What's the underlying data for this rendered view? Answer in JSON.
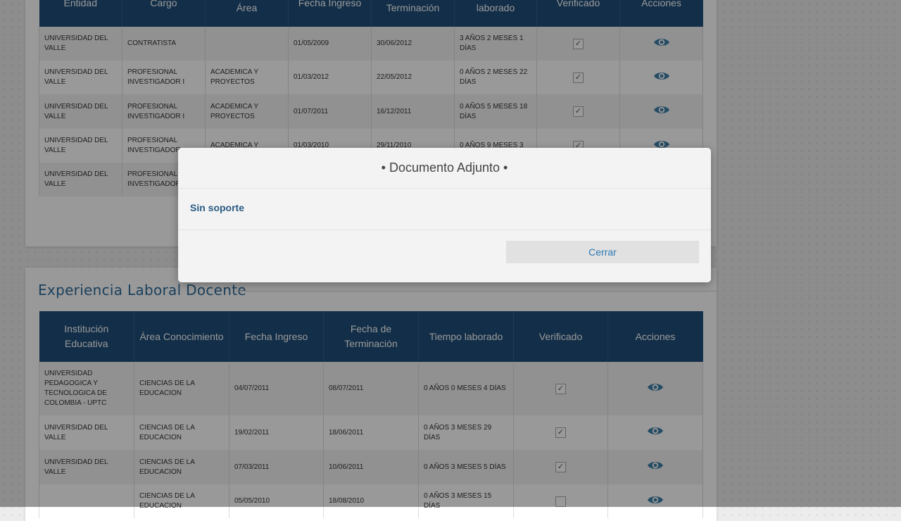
{
  "laboral": {
    "headers": [
      "Entidad",
      "Cargo",
      "Área",
      "Fecha Ingreso",
      "Terminación",
      "laborado",
      "Verificado",
      "Acciones"
    ],
    "rows": [
      {
        "entidad": "UNIVERSIDAD DEL VALLE",
        "cargo": "CONTRATISTA",
        "area": "",
        "ingreso": "01/05/2009",
        "terminacion": "30/06/2012",
        "tiempo": "3 AÑOS 2 MESES 1 DÍAS",
        "verificado": true
      },
      {
        "entidad": "UNIVERSIDAD DEL VALLE",
        "cargo": "PROFESIONAL INVESTIGADOR I",
        "area": "ACADEMICA Y PROYECTOS",
        "ingreso": "01/03/2012",
        "terminacion": "22/05/2012",
        "tiempo": "0 AÑOS 2 MESES 22 DÍAS",
        "verificado": true
      },
      {
        "entidad": "UNIVERSIDAD DEL VALLE",
        "cargo": "PROFESIONAL INVESTIGADOR I",
        "area": "ACADEMICA Y PROYECTOS",
        "ingreso": "01/07/2011",
        "terminacion": "16/12/2011",
        "tiempo": "0 AÑOS 5 MESES 18 DÍAS",
        "verificado": true
      },
      {
        "entidad": "UNIVERSIDAD DEL VALLE",
        "cargo": "PROFESIONAL INVESTIGADOR",
        "area": "ACADEMICA Y",
        "ingreso": "01/03/2010",
        "terminacion": "29/11/2010",
        "tiempo": "0 AÑOS 9 MESES 3",
        "verificado": true
      },
      {
        "entidad": "UNIVERSIDAD DEL VALLE",
        "cargo": "PROFESIONAL INVESTIGADOR",
        "area": "",
        "ingreso": "",
        "terminacion": "",
        "tiempo": "",
        "verificado": true
      }
    ]
  },
  "docente": {
    "title": "Experiencia Laboral Docente",
    "headers": [
      "Institución Educativa",
      "Área Conocimiento",
      "Fecha Ingreso",
      "Fecha de Terminación",
      "Tiempo laborado",
      "Verificado",
      "Acciones"
    ],
    "rows": [
      {
        "institucion": "UNIVERSIDAD PEDAGOGICA Y TECNOLOGICA DE COLOMBIA - UPTC",
        "area": "CIENCIAS DE LA EDUCACION",
        "ingreso": "04/07/2011",
        "terminacion": "08/07/2011",
        "tiempo": "0 AÑOS 0 MESES 4 DÍAS",
        "verificado": true
      },
      {
        "institucion": "UNIVERSIDAD DEL VALLE",
        "area": "CIENCIAS DE LA EDUCACION",
        "ingreso": "19/02/2011",
        "terminacion": "18/06/2011",
        "tiempo": "0 AÑOS 3 MESES 29 DÍAS",
        "verificado": true
      },
      {
        "institucion": "UNIVERSIDAD DEL VALLE",
        "area": "CIENCIAS DE LA EDUCACION",
        "ingreso": "07/03/2011",
        "terminacion": "10/06/2011",
        "tiempo": "0 AÑOS 3 MESES 5 DÍAS",
        "verificado": true
      },
      {
        "institucion": "",
        "area": "CIENCIAS DE LA EDUCACION",
        "ingreso": "05/05/2010",
        "terminacion": "18/08/2010",
        "tiempo": "0 AÑOS 3 MESES 15 DÍAS",
        "verificado": false
      }
    ]
  },
  "modal": {
    "title": "• Documento Adjunto •",
    "body": "Sin soporte",
    "close_label": "Cerrar"
  },
  "icons": {
    "view": "eye-icon",
    "check": "checkmark-icon"
  },
  "colors": {
    "header_bg": "#1f4e79",
    "accent": "#2e6b99",
    "eye": "#3f7fa8"
  }
}
